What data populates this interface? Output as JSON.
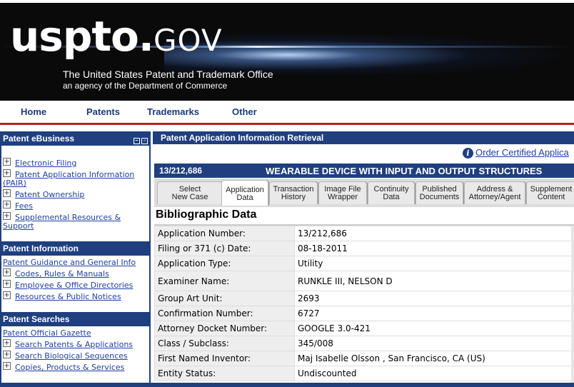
{
  "banner": {
    "logo": "uspto",
    "logo_dot": ".",
    "logo_suffix": "GOV",
    "tagline": "The United States Patent and Trademark Office",
    "subtagline": "an agency of the Department of Commerce"
  },
  "topnav": {
    "items": [
      {
        "label": "Home"
      },
      {
        "label": "Patents"
      },
      {
        "label": "Trademarks"
      },
      {
        "label": "Other"
      }
    ]
  },
  "sidebar": {
    "section1": {
      "title": "Patent eBusiness",
      "items": [
        {
          "label": "Electronic Filing"
        },
        {
          "label": "Patent Application Information"
        },
        {
          "label": "(PAIR)"
        },
        {
          "label": "Patent Ownership"
        },
        {
          "label": "Fees"
        },
        {
          "label": "Supplemental Resources &"
        },
        {
          "label": "Support"
        }
      ]
    },
    "section2": {
      "title": "Patent Information",
      "items": [
        {
          "label": "Patent Guidance and General Info"
        },
        {
          "label": "Codes, Rules & Manuals"
        },
        {
          "label": "Employee & Office Directories"
        },
        {
          "label": "Resources & Public Notices"
        }
      ]
    },
    "section3": {
      "title": "Patent Searches",
      "items": [
        {
          "label": "Patent Official Gazette"
        },
        {
          "label": "Search Patents & Applications"
        },
        {
          "label": "Search Biological Sequences"
        },
        {
          "label": "Copies, Products & Services"
        }
      ]
    }
  },
  "main": {
    "header": "Patent Application Information Retrieval",
    "order_link": "Order Certified Applica",
    "info_icon_glyph": "i",
    "application_number_banner": "13/212,686",
    "title": "WEARABLE DEVICE WITH INPUT AND OUTPUT STRUCTURES",
    "tabs": [
      {
        "line1": "Select",
        "line2": "New Case"
      },
      {
        "line1": "Application",
        "line2": "Data"
      },
      {
        "line1": "Transaction",
        "line2": "History"
      },
      {
        "line1": "Image File",
        "line2": "Wrapper"
      },
      {
        "line1": "Continuity",
        "line2": "Data"
      },
      {
        "line1": "Published",
        "line2": "Documents"
      },
      {
        "line1": "Address &",
        "line2": "Attorney/Agent"
      },
      {
        "line1": "Supplement",
        "line2": "Content"
      }
    ],
    "section_title": "Bibliographic Data",
    "rows": [
      {
        "label": "Application Number:",
        "value": "13/212,686"
      },
      {
        "label": "Filing or 371 (c) Date:",
        "value": "08-18-2011"
      },
      {
        "label": "Application Type:",
        "value": "Utility"
      },
      {
        "label": "Examiner Name:",
        "value": "RUNKLE III, NELSON D"
      },
      {
        "label": "Group Art Unit:",
        "value": "2693"
      },
      {
        "label": "Confirmation Number:",
        "value": "6727"
      },
      {
        "label": "Attorney Docket Number:",
        "value": "GOOGLE 3.0-421"
      },
      {
        "label": "Class / Subclass:",
        "value": "345/008"
      },
      {
        "label": "First Named Inventor:",
        "value": "Maj Isabelle Olsson , San Francisco, CA (US)"
      },
      {
        "label": "Entity Status:",
        "value": "Undiscounted"
      }
    ]
  },
  "colors": {
    "navy": "#1f3f7f",
    "link": "#1f3fa0",
    "accent_red": "#b22222"
  }
}
